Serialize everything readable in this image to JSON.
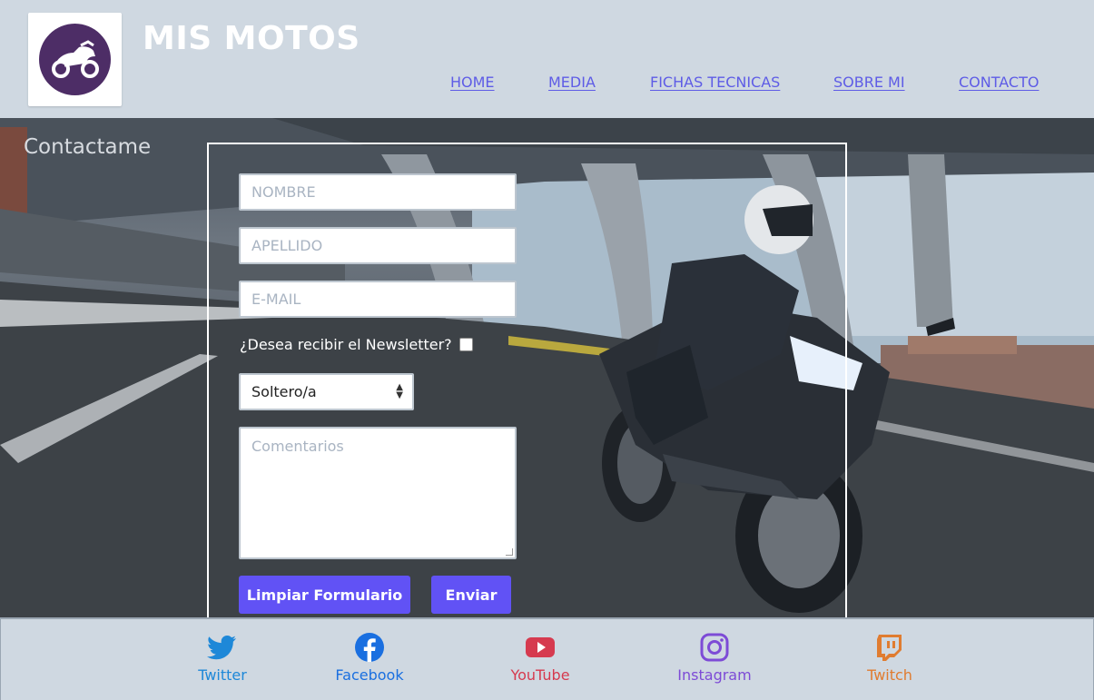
{
  "header": {
    "title": "MIS MOTOS",
    "logo_icon": "motorcycle-icon",
    "nav": [
      {
        "label": "HOME"
      },
      {
        "label": "MEDIA"
      },
      {
        "label": "FICHAS TECNICAS"
      },
      {
        "label": "SOBRE MI"
      },
      {
        "label": "CONTACTO"
      }
    ]
  },
  "contact": {
    "title": "Contactame",
    "nombre_placeholder": "NOMBRE",
    "apellido_placeholder": "APELLIDO",
    "email_placeholder": "E-MAIL",
    "newsletter_label": "¿Desea recibir el Newsletter?",
    "newsletter_checked": false,
    "estado_civil_selected": "Soltero/a",
    "comentarios_placeholder": "Comentarios",
    "clear_button": "Limpiar Formulario",
    "submit_button": "Enviar"
  },
  "footer": {
    "social": [
      {
        "label": "Twitter",
        "icon": "twitter-icon",
        "color": "#1e88d8"
      },
      {
        "label": "Facebook",
        "icon": "facebook-icon",
        "color": "#1a6fe0"
      },
      {
        "label": "YouTube",
        "icon": "youtube-icon",
        "color": "#d63a4f"
      },
      {
        "label": "Instagram",
        "icon": "instagram-icon",
        "color": "#7d4bd6"
      },
      {
        "label": "Twitch",
        "icon": "twitch-icon",
        "color": "#e07c30"
      }
    ]
  }
}
